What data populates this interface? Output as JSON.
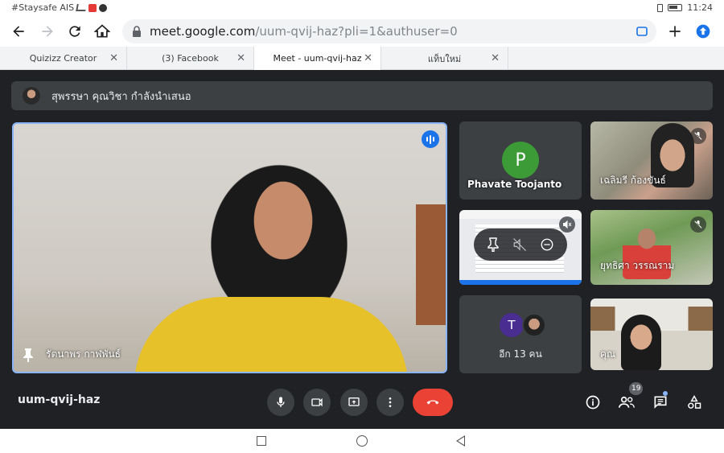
{
  "status_bar": {
    "carrier": "#Staysafe AIS",
    "time": "11:24"
  },
  "browser": {
    "url_host": "meet.google.com",
    "url_path": "/uum-qvij-haz?pli=1&authuser=0",
    "tabs": [
      {
        "label": "Quizizz Creator",
        "active": false
      },
      {
        "label": "(3) Facebook",
        "active": false
      },
      {
        "label": "Meet - uum-qvij-haz",
        "active": true
      },
      {
        "label": "แท็บใหม่",
        "active": false
      }
    ]
  },
  "meet": {
    "presenting_text": "สุพรรษา คุณวิชา กำลังนำเสนอ",
    "main_tile": {
      "name": "รัตนาพร กาฬพันธ์"
    },
    "tiles": [
      {
        "name": "Phavate Toojanto",
        "avatar_letter": "P",
        "avatar_color": "#3c9a37"
      },
      {
        "name": "เฉลิมรี ก้องขันธ์"
      },
      {
        "name": ""
      },
      {
        "name": "ยุทธิศา วรรณราม"
      },
      {
        "name": "อีก 13 คน",
        "avatar_letter": "T",
        "avatar_color": "#4a2d91"
      },
      {
        "name": "คุณ"
      }
    ],
    "meeting_code": "uum-qvij-haz",
    "participants_count": "19",
    "accent_end_call": "#ea4335",
    "accent_active": "#8ab4f8"
  }
}
